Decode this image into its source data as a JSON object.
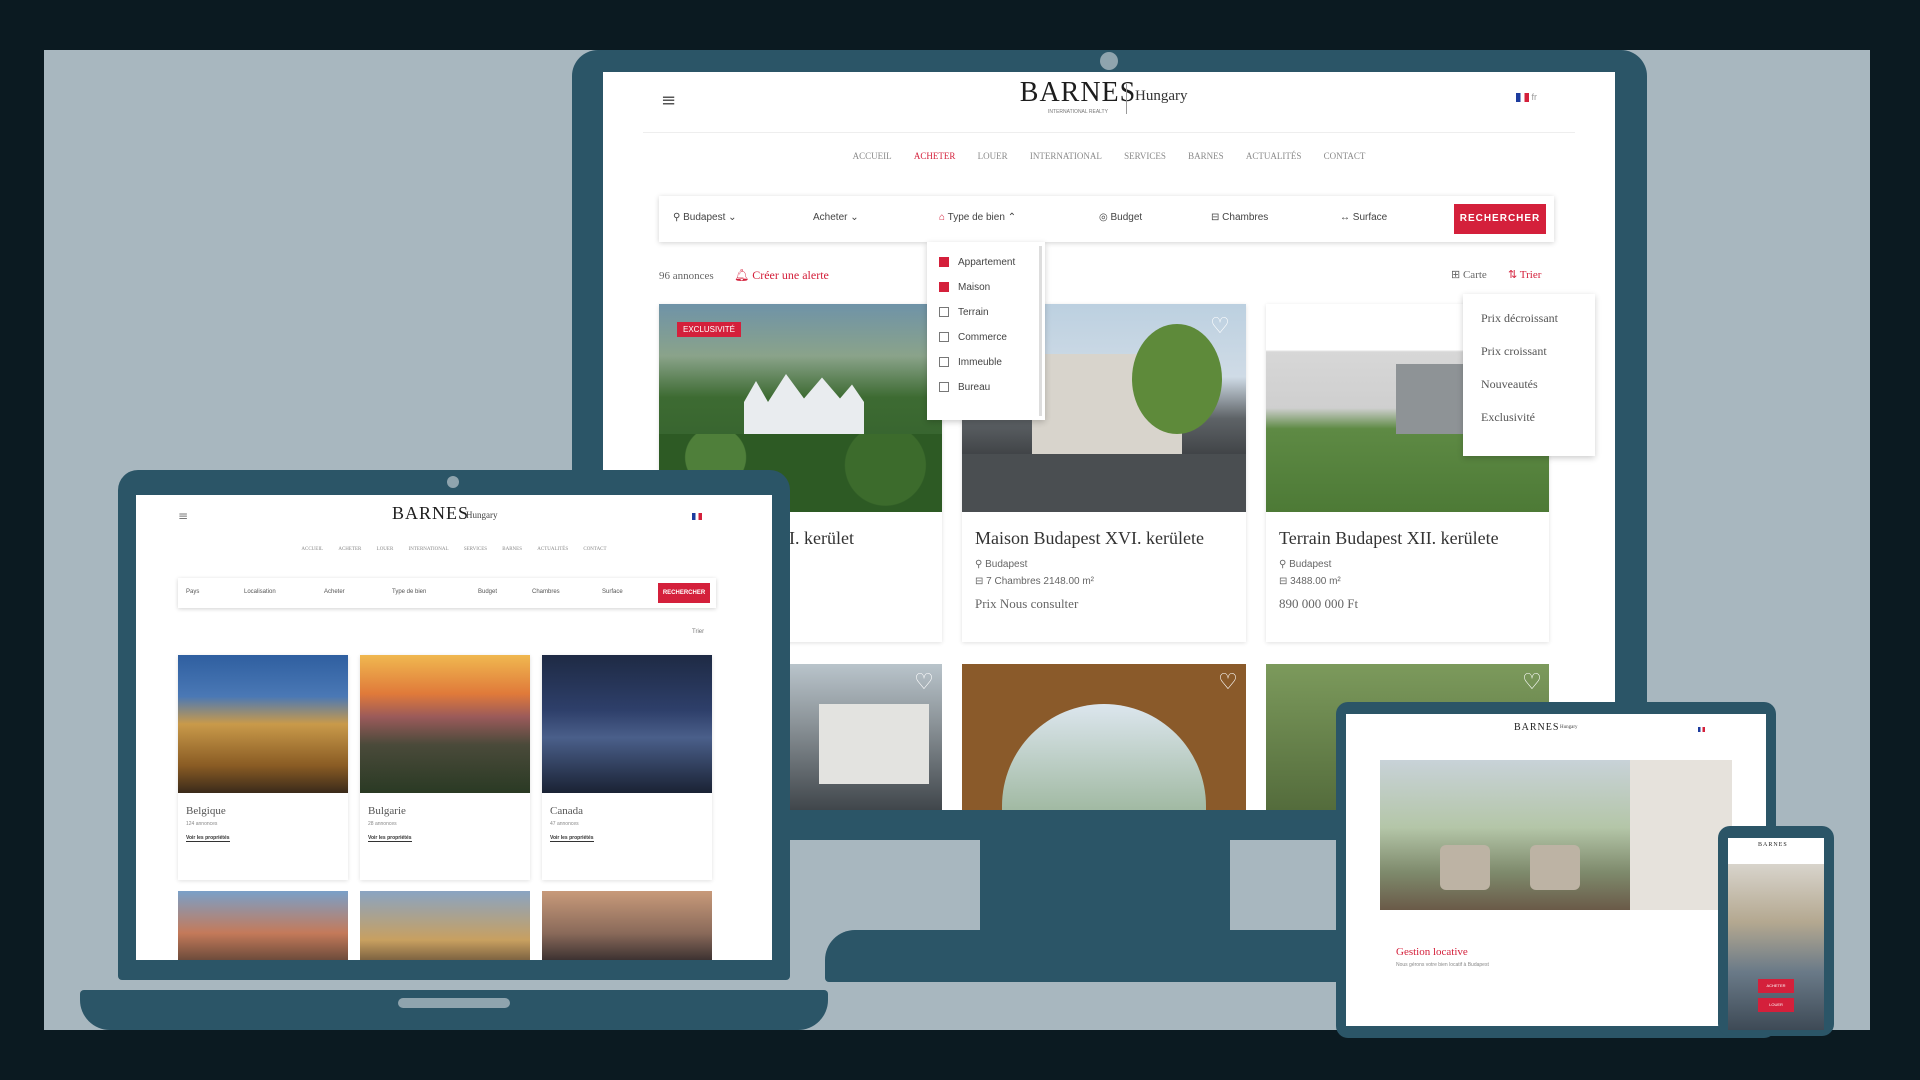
{
  "brand": {
    "name": "BARNES",
    "region": "Hungary",
    "lang": "fr",
    "tagline": "INTERNATIONAL REALTY"
  },
  "nav": [
    "ACCUEIL",
    "ACHETER",
    "LOUER",
    "INTERNATIONAL",
    "SERVICES",
    "BARNES",
    "ACTUALITÉS",
    "CONTACT"
  ],
  "search": {
    "location": "Budapest",
    "action": "Acheter",
    "type": "Type de bien",
    "budget": "Budget",
    "rooms": "Chambres",
    "surface": "Surface",
    "button": "RECHERCHER"
  },
  "type_options": [
    {
      "label": "Appartement",
      "checked": true
    },
    {
      "label": "Maison",
      "checked": true
    },
    {
      "label": "Terrain",
      "checked": false
    },
    {
      "label": "Commerce",
      "checked": false
    },
    {
      "label": "Immeuble",
      "checked": false
    },
    {
      "label": "Bureau",
      "checked": false
    }
  ],
  "results": {
    "count": "96 annonces",
    "alert": "Créer une alerte",
    "map": "Carte",
    "sort": "Trier"
  },
  "sort_options": [
    "Prix décroissant",
    "Prix croissant",
    "Nouveautés",
    "Exclusivité"
  ],
  "listings": [
    {
      "badge": "EXCLUSIVITÉ",
      "title": "I. kerület"
    },
    {
      "title": "Maison Budapest XVI. kerülete",
      "city": "Budapest",
      "details": "7 Chambres 2148.00 m²",
      "price": "Prix Nous consulter"
    },
    {
      "title": "Terrain Budapest XII. kerülete",
      "city": "Budapest",
      "details": "3488.00 m²",
      "price": "890 000 000 Ft"
    }
  ],
  "laptop": {
    "search": {
      "country": "Pays",
      "location": "Localisation",
      "action": "Acheter",
      "type": "Type de bien",
      "budget": "Budget",
      "rooms": "Chambres",
      "surface": "Surface",
      "button": "RECHERCHER"
    },
    "sort": "Trier",
    "countries": [
      {
        "name": "Belgique",
        "count": "124 annonces",
        "link": "Voir les propriétés"
      },
      {
        "name": "Bulgarie",
        "count": "28 annonces",
        "link": "Voir les propriétés"
      },
      {
        "name": "Canada",
        "count": "47 annonces",
        "link": "Voir les propriétés"
      }
    ]
  },
  "tablet": {
    "title": "Gestion locative",
    "subtitle": "Nous gérons votre bien locatif à Budapest"
  },
  "phone": {
    "btn1": "ACHETER",
    "btn2": "LOUER"
  },
  "colors": {
    "background": "#0b1a21",
    "canvas": "#a8b7bf",
    "device": "#2b5567",
    "accent": "#d4203b"
  }
}
